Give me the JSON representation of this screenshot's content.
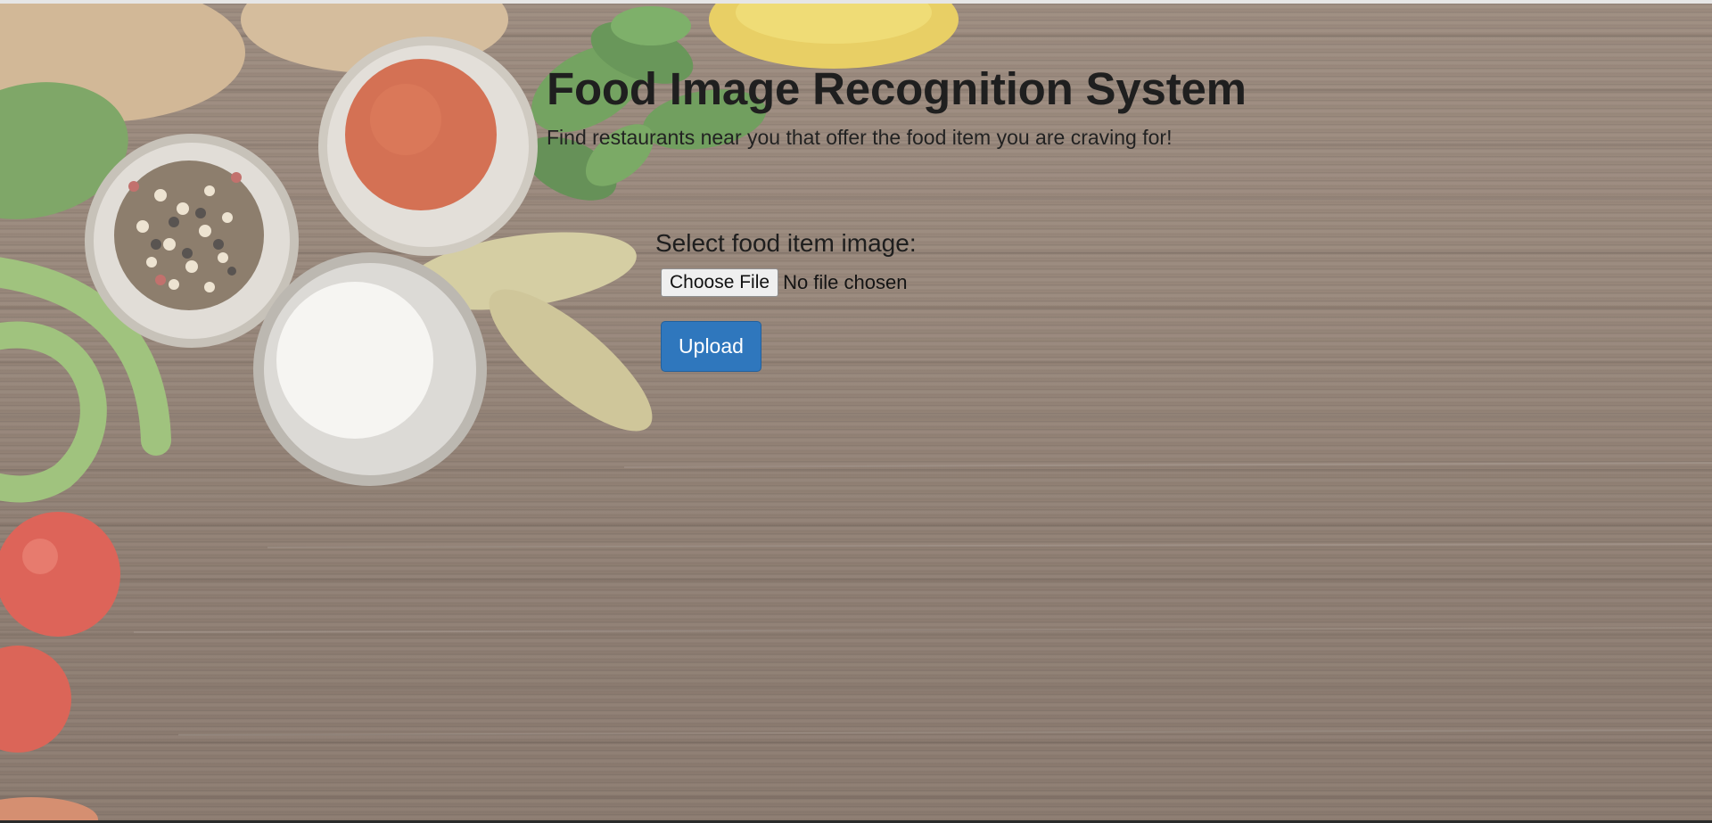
{
  "header": {
    "title": "Food Image Recognition System",
    "subtitle": "Find restaurants near you that offer the food item you are craving for!"
  },
  "form": {
    "label": "Select food item image:",
    "choose_file_label": "Choose File",
    "file_status": "No file chosen",
    "upload_label": "Upload"
  },
  "colors": {
    "upload_button": "#2f77bd",
    "background_wood": "#7c6656",
    "title_text": "#1f1f1f"
  }
}
